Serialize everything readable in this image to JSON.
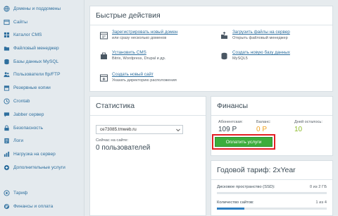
{
  "sidebar": {
    "items": [
      {
        "label": "Домены и поддомены",
        "icon": "globe-icon"
      },
      {
        "label": "Сайты",
        "icon": "window-icon"
      },
      {
        "label": "Каталог CMS",
        "icon": "cms-icon"
      },
      {
        "label": "Файловый менеджер",
        "icon": "folder-icon"
      },
      {
        "label": "Базы данных MySQL",
        "icon": "database-icon"
      },
      {
        "label": "Пользователи ftp/FTP",
        "icon": "users-icon"
      },
      {
        "label": "Резервные копии",
        "icon": "archive-icon"
      },
      {
        "label": "Crontab",
        "icon": "clock-icon"
      },
      {
        "label": "Jabber сервер",
        "icon": "chat-icon"
      },
      {
        "label": "Безопасность",
        "icon": "lock-icon"
      },
      {
        "label": "Логи",
        "icon": "log-icon"
      },
      {
        "label": "Нагрузка на сервер",
        "icon": "chart-icon"
      },
      {
        "label": "Дополнительные услуги",
        "icon": "plus-icon"
      },
      {
        "label": "Тариф",
        "icon": "tariff-icon"
      },
      {
        "label": "Финансы и оплата",
        "icon": "finance-icon"
      }
    ]
  },
  "quick_actions": {
    "title": "Быстрые действия",
    "items": [
      {
        "title": "Зарегистрировать новый домен",
        "desc": "или сразу несколько доменов",
        "icon": "domain-register-icon"
      },
      {
        "title": "Загрузить файлы на сервер",
        "desc": "Открыть файловый менеджер",
        "icon": "upload-icon"
      },
      {
        "title": "Установить CMS",
        "desc": "Bitrix, Wordpress, Drupal и др.",
        "icon": "cms-install-icon"
      },
      {
        "title": "Создать новую базу данных",
        "desc": "MySQL5",
        "icon": "database-create-icon"
      },
      {
        "title": "Создать новый сайт",
        "desc": "Указать директорию расположения",
        "icon": "site-create-icon"
      }
    ]
  },
  "statistics": {
    "title": "Статистика",
    "select_value": "ce73085.tmweb.ru",
    "online_label": "Сейчас на сайте:",
    "online_value": "0 пользователей"
  },
  "finance": {
    "title": "Финансы",
    "cols": [
      {
        "label": "Абонентская:",
        "value": "109 Р",
        "color": "#3a4a55"
      },
      {
        "label": "Баланс:",
        "value": "0 Р",
        "color": "#f0a21f"
      },
      {
        "label": "Дней осталось:",
        "value": "10",
        "color": "#8dbb2a"
      }
    ],
    "pay_button": "Оплатить услуги"
  },
  "tariff": {
    "title": "Годовой тариф: 2xYear",
    "rows": [
      {
        "label": "Дисковое пространство (SSD):",
        "value": "0 из 2 ГБ",
        "fill": 0.0
      },
      {
        "label": "Количество сайтов:",
        "value": "1 из 4",
        "fill": 0.25
      }
    ]
  },
  "colors": {
    "link": "#2e6f9e",
    "pay_button": "#3cad3c",
    "highlight_border": "#e31e24"
  }
}
